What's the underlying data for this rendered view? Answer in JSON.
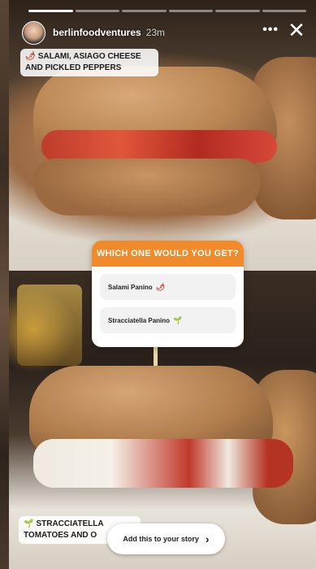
{
  "story": {
    "progress": {
      "segments": 6,
      "completed": 1
    },
    "user": {
      "name": "berlinfoodventures",
      "time": "23m"
    },
    "top_caption": "SALAMI, ASIAGO CHEESE AND PICKLED PEPPERS",
    "top_caption_icon": "pepper-icon",
    "bottom_caption": "STRACCIATELLA TOMATOES AND O",
    "bottom_caption_icon": "sprout-icon",
    "poll": {
      "question": "WHICH ONE WOULD YOU GET?",
      "options": [
        {
          "label": "Salami Panino",
          "emoji": "🌶"
        },
        {
          "label": "Stracciatella Panino",
          "emoji": "🌱"
        }
      ],
      "accent_color": "#f08a2a"
    },
    "add_story_label": "Add this to your story",
    "more_icon": "more-dots-icon",
    "close_icon": "close-icon"
  }
}
